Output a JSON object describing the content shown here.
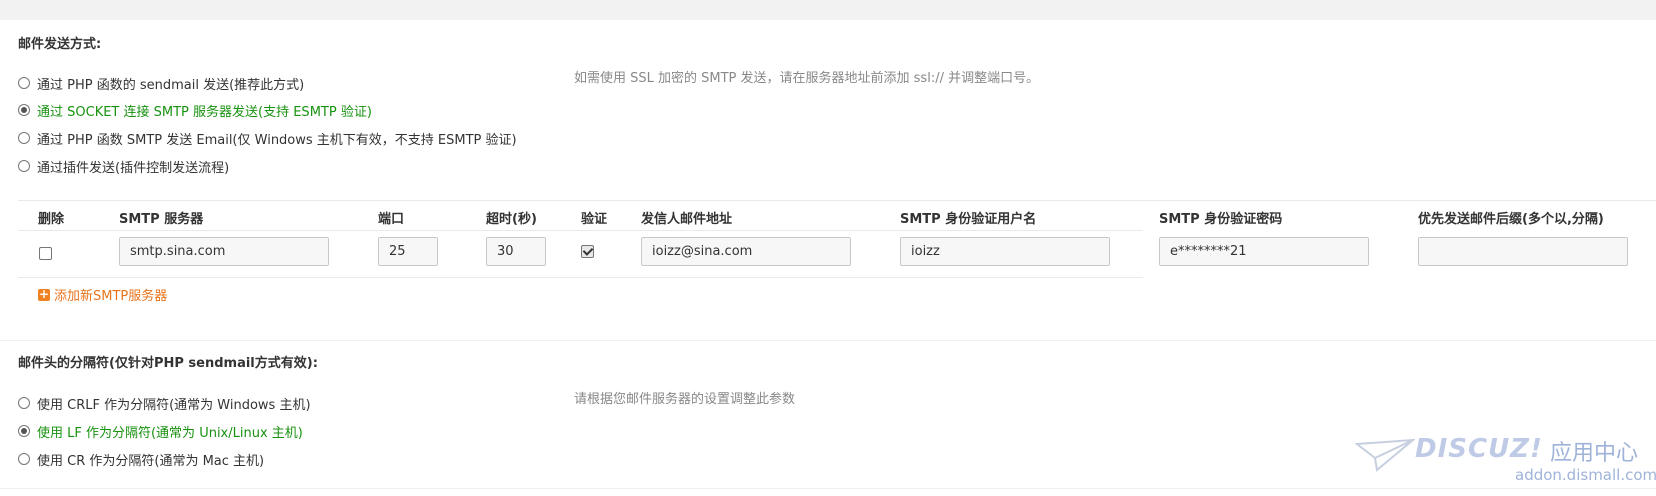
{
  "mail_send": {
    "title": "邮件发送方式:",
    "tip": "如需使用 SSL 加密的 SMTP 发送，请在服务器地址前添加 ssl:// 并调整端口号。",
    "options": [
      {
        "label": "通过 PHP 函数的 sendmail 发送(推荐此方式)",
        "checked": false
      },
      {
        "label": "通过 SOCKET 连接 SMTP 服务器发送(支持 ESMTP 验证)",
        "checked": true
      },
      {
        "label": "通过 PHP 函数 SMTP 发送 Email(仅 Windows 主机下有效，不支持 ESMTP 验证)",
        "checked": false
      },
      {
        "label": "通过插件发送(插件控制发送流程)",
        "checked": false
      }
    ]
  },
  "smtp_table": {
    "headers": [
      "删除",
      "SMTP 服务器",
      "端口",
      "超时(秒)",
      "验证",
      "发信人邮件地址",
      "SMTP 身份验证用户名",
      "SMTP 身份验证密码",
      "优先发送邮件后缀(多个以,分隔)"
    ],
    "row": {
      "delete_checked": false,
      "server": "smtp.sina.com",
      "port": "25",
      "timeout": "30",
      "auth_checked": true,
      "from": "ioizz@sina.com",
      "username": "ioizz",
      "password": "e********21",
      "suffix": ""
    },
    "add_label": "添加新SMTP服务器"
  },
  "separator": {
    "title": "邮件头的分隔符(仅针对PHP sendmail方式有效):",
    "tip": "请根据您邮件服务器的设置调整此参数",
    "options": [
      {
        "label": "使用 CRLF 作为分隔符(通常为 Windows 主机)",
        "checked": false
      },
      {
        "label": "使用 LF 作为分隔符(通常为 Unix/Linux 主机)",
        "checked": true
      },
      {
        "label": "使用 CR 作为分隔符(通常为 Mac 主机)",
        "checked": false
      }
    ]
  },
  "watermark": {
    "brand": "DISCUZ!",
    "cn": "应用中心",
    "url": "addon.dismall.com"
  },
  "colors": {
    "checked_text": "#17920f",
    "link": "#e8731b",
    "tip": "#888888"
  }
}
